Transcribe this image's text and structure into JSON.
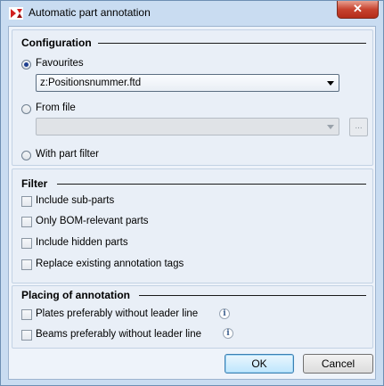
{
  "window": {
    "title": "Automatic part annotation",
    "close_label": "✕",
    "app_icon": "hicad-logo-icon"
  },
  "configuration": {
    "title": "Configuration",
    "favourites_label": "Favourites",
    "favourites_selected": true,
    "favourites_value": "z:Positionsnummer.ftd",
    "from_file_label": "From file",
    "from_file_value": "",
    "browse_label": "...",
    "with_part_filter_label": "With part filter"
  },
  "filter": {
    "title": "Filter",
    "include_sub_parts": "Include sub-parts",
    "only_bom_relevant": "Only BOM-relevant parts",
    "include_hidden": "Include hidden parts",
    "replace_existing": "Replace existing annotation tags"
  },
  "placing": {
    "title": "Placing of annotation",
    "plates_label": "Plates preferably without leader line",
    "beams_label": "Beams preferably without leader line",
    "info_icon": "i"
  },
  "buttons": {
    "ok": "OK",
    "cancel": "Cancel"
  },
  "colors": {
    "frame": "#c9dcf1",
    "client": "#eef3fa",
    "close": "#c7432f",
    "radio_selected": "#1e3f8f"
  }
}
